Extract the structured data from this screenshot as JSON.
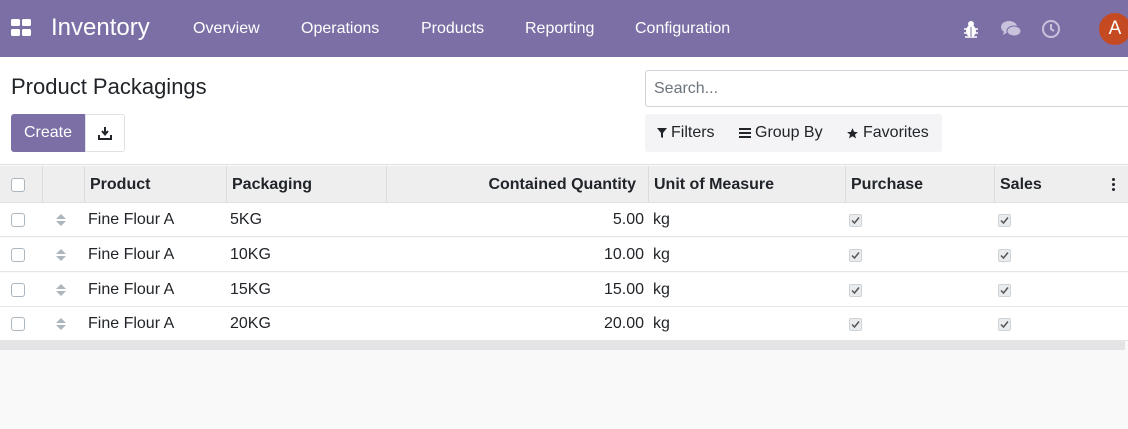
{
  "navbar": {
    "app_title": "Inventory",
    "menu": [
      "Overview",
      "Operations",
      "Products",
      "Reporting",
      "Configuration"
    ],
    "avatar_letter": "A",
    "colors": {
      "bar": "#7c6fa5",
      "avatar": "#c64a21"
    },
    "icons": [
      "apps-icon",
      "bug-icon",
      "chat-icon",
      "clock-icon"
    ]
  },
  "control": {
    "page_title": "Product Packagings",
    "create_label": "Create",
    "download_icon": "download-icon",
    "search_placeholder": "Search...",
    "filters_label": "Filters",
    "group_by_label": "Group By",
    "favorites_label": "Favorites"
  },
  "table": {
    "columns": [
      "Product",
      "Packaging",
      "Contained Quantity",
      "Unit of Measure",
      "Purchase",
      "Sales"
    ],
    "rows": [
      {
        "product": "Fine Flour A",
        "packaging": "5KG",
        "qty": "5.00",
        "uom": "kg",
        "purchase": true,
        "sales": true
      },
      {
        "product": "Fine Flour A",
        "packaging": "10KG",
        "qty": "10.00",
        "uom": "kg",
        "purchase": true,
        "sales": true
      },
      {
        "product": "Fine Flour A",
        "packaging": "15KG",
        "qty": "15.00",
        "uom": "kg",
        "purchase": true,
        "sales": true
      },
      {
        "product": "Fine Flour A",
        "packaging": "20KG",
        "qty": "20.00",
        "uom": "kg",
        "purchase": true,
        "sales": true
      }
    ]
  }
}
